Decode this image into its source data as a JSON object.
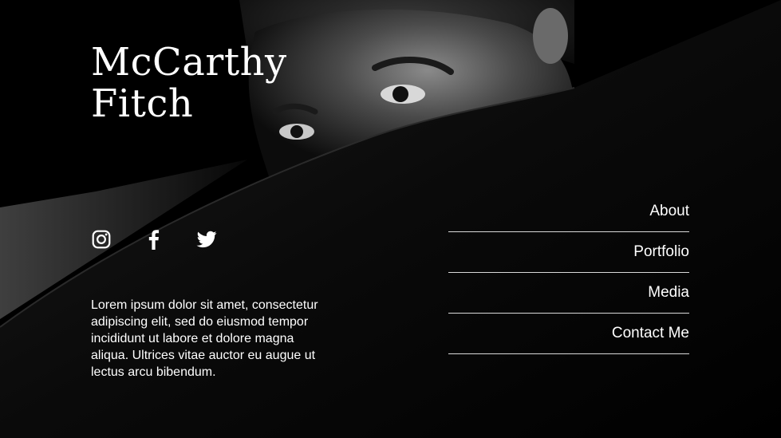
{
  "site": {
    "title_line1": "McCarthy",
    "title_line2": "Fitch"
  },
  "social": [
    {
      "name": "instagram-icon",
      "label": "Instagram"
    },
    {
      "name": "facebook-icon",
      "label": "Facebook"
    },
    {
      "name": "twitter-icon",
      "label": "Twitter"
    }
  ],
  "bio": {
    "text": "Lorem ipsum dolor sit amet, consectetur adipiscing elit, sed do eiusmod tempor incididunt ut labore et dolore magna aliqua. Ultrices vitae auctor eu augue ut lectus arcu bibendum."
  },
  "nav": {
    "items": [
      {
        "label": "About"
      },
      {
        "label": "Portfolio"
      },
      {
        "label": "Media"
      },
      {
        "label": "Contact Me"
      }
    ]
  },
  "colors": {
    "background": "#000000",
    "text": "#ffffff",
    "divider": "#d9d9d9"
  }
}
